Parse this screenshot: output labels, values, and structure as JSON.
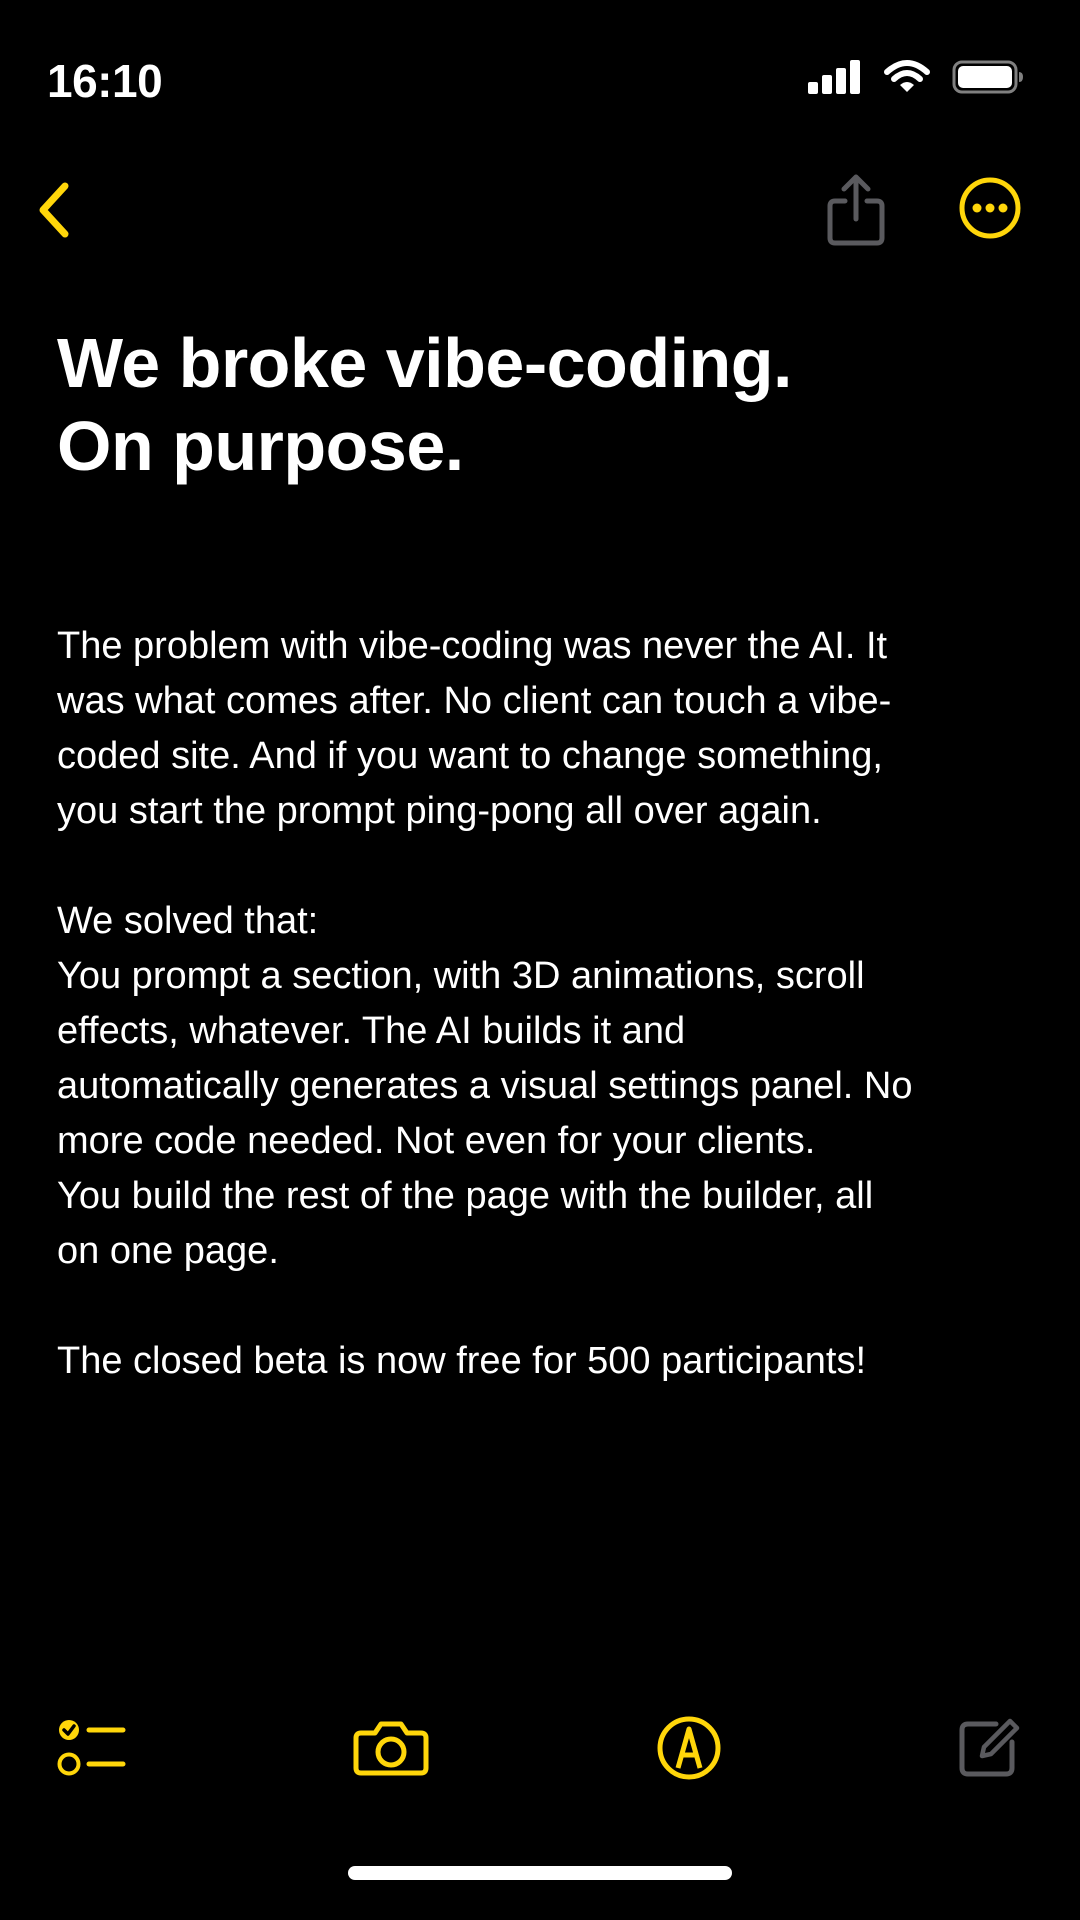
{
  "status_bar": {
    "time": "16:10",
    "icons": [
      "cellular-signal-icon",
      "wifi-icon",
      "battery-icon"
    ]
  },
  "nav": {
    "back_icon": "chevron-left-icon",
    "share_icon": "share-icon",
    "more_icon": "ellipsis-circle-icon"
  },
  "note": {
    "title_lines": [
      "We broke vibe-coding.",
      "On purpose."
    ],
    "paragraphs": [
      {
        "lines": [
          "The problem with vibe-coding was never the AI. It",
          "was what comes after. No client can touch a vibe-",
          "coded site. And if you want to change something,",
          "you start the prompt ping-pong all over again."
        ]
      },
      {
        "lines": [
          "We solved that:",
          "You prompt a section, with 3D animations, scroll",
          "effects, whatever. The AI builds it and",
          "automatically generates a visual settings panel. No",
          "more code needed. Not even for your clients.",
          "You build the rest of the page with the builder, all",
          "on one page."
        ]
      },
      {
        "lines": [
          "The closed beta is now free for 500 participants!"
        ]
      }
    ]
  },
  "toolbar": {
    "icons": [
      "checklist-icon",
      "camera-icon",
      "markup-pen-icon",
      "compose-icon"
    ]
  },
  "colors": {
    "accent": "#FFD60A",
    "background": "#000000",
    "text": "#FFFFFF",
    "disabled_icon": "#5A5A5E"
  }
}
